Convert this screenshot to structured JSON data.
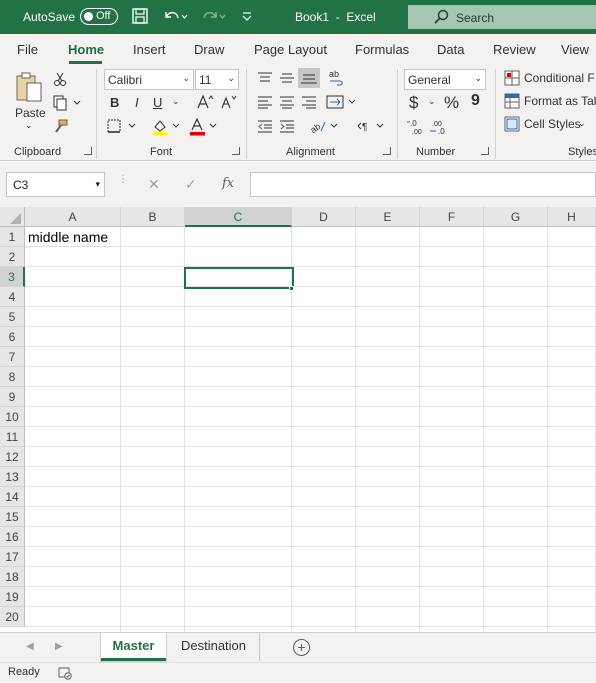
{
  "titlebar": {
    "autosave_label": "AutoSave",
    "autosave_state": "Off",
    "doc_title": "Book1  -  Excel",
    "search_placeholder": "Search",
    "accent": "#217346"
  },
  "tabs": [
    "File",
    "Home",
    "Insert",
    "Draw",
    "Page Layout",
    "Formulas",
    "Data",
    "Review",
    "View"
  ],
  "active_tab": "Home",
  "ribbon": {
    "clipboard": {
      "label": "Clipboard",
      "paste": "Paste"
    },
    "font": {
      "label": "Font",
      "font_name": "Calibri",
      "font_size": "11",
      "bold": "B",
      "italic": "I",
      "underline": "U"
    },
    "alignment": {
      "label": "Alignment"
    },
    "number": {
      "label": "Number",
      "format": "General",
      "currency": "$",
      "percent": "%",
      "comma": "9"
    },
    "styles": {
      "label": "Styles",
      "conditional": "Conditional F",
      "format_table": "Format as Tab",
      "cell_styles": "Cell Styles"
    }
  },
  "formula_bar": {
    "name_box": "C3",
    "fx": "fx",
    "content": ""
  },
  "columns": [
    "A",
    "B",
    "C",
    "D",
    "E",
    "F",
    "G",
    "H"
  ],
  "rows": [
    "1",
    "2",
    "3",
    "4",
    "5",
    "6",
    "7",
    "8",
    "9",
    "10",
    "11",
    "12",
    "13",
    "14",
    "15",
    "16",
    "17",
    "18",
    "19",
    "20"
  ],
  "selected_cell": {
    "column": "C",
    "row": "3"
  },
  "cells": {
    "A1": "middle name"
  },
  "sheets": [
    "Master",
    "Destination"
  ],
  "active_sheet": "Master",
  "status": {
    "text": "Ready"
  }
}
